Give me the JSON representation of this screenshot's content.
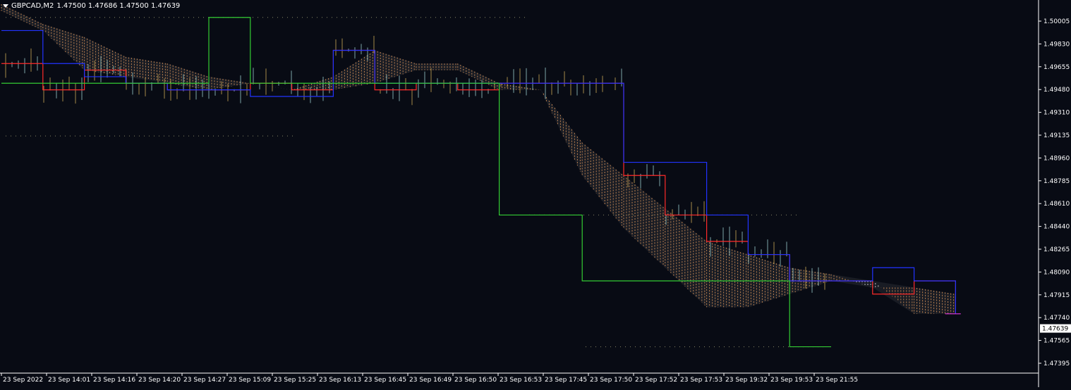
{
  "header": {
    "symbol": "GBPCAD,M2",
    "ohlc": "1.47500 1.47686 1.47500 1.47639"
  },
  "colors": {
    "background": "#080b14",
    "axis": "#ffffff",
    "tenkan": "#ff2a2a",
    "kijun": "#2233ff",
    "chikou": "#33cc33",
    "span_a": "#f4a460",
    "span_b": "#ffffff",
    "price_candles": "#99cccc",
    "close_line": "#cc33cc",
    "grid_dots": "#888866"
  },
  "chart_data": {
    "type": "line",
    "title": "GBPCAD,M2",
    "ylim": [
      1.473,
      1.501
    ],
    "y_ticks": [
      "1.50005",
      "1.49830",
      "1.49655",
      "1.49480",
      "1.49310",
      "1.49135",
      "1.48960",
      "1.48785",
      "1.48610",
      "1.48440",
      "1.48265",
      "1.48090",
      "1.47915",
      "1.47740",
      "1.47565",
      "1.47395"
    ],
    "x_ticks": [
      "23 Sep 2022",
      "23 Sep 14:01",
      "23 Sep 14:16",
      "23 Sep 14:20",
      "23 Sep 14:27",
      "23 Sep 15:09",
      "23 Sep 15:25",
      "23 Sep 16:13",
      "23 Sep 16:45",
      "23 Sep 16:49",
      "23 Sep 16:50",
      "23 Sep 16:53",
      "23 Sep 17:45",
      "23 Sep 17:50",
      "23 Sep 17:52",
      "23 Sep 17:53",
      "23 Sep 19:32",
      "23 Sep 19:53",
      "23 Sep 21:55"
    ],
    "current_price": "1.47639",
    "x": [
      0,
      4,
      8,
      12,
      16,
      20,
      24,
      28,
      32,
      36,
      40,
      44,
      48,
      52,
      56,
      60,
      64,
      68,
      72,
      76,
      80,
      84,
      88,
      92
    ],
    "series": [
      {
        "values": [
          1.4965,
          1.4945,
          1.496,
          1.495,
          1.4945,
          1.4945,
          1.495,
          1.4945,
          1.4975,
          1.4945,
          1.495,
          1.4945,
          1.495,
          1.495,
          1.495,
          1.488,
          1.485,
          1.483,
          1.482,
          1.48,
          1.48,
          1.479,
          1.48,
          1.4775
        ]
      },
      {
        "values": [
          1.499,
          1.4965,
          1.4955,
          1.495,
          1.4945,
          1.4945,
          1.494,
          1.494,
          1.4975,
          1.495,
          1.495,
          1.495,
          1.495,
          1.495,
          1.495,
          1.489,
          1.489,
          1.485,
          1.482,
          1.48,
          1.48,
          1.481,
          1.48,
          1.4775
        ]
      },
      {
        "values": [
          1.495,
          1.495,
          1.495,
          1.495,
          1.495,
          1.5,
          1.495,
          1.495,
          1.495,
          1.495,
          1.495,
          1.495,
          1.485,
          1.485,
          1.48,
          1.48,
          1.48,
          1.48,
          1.48,
          1.475,
          1.475,
          null,
          null,
          null
        ]
      },
      {
        "values": [
          1.501,
          1.4995,
          1.4985,
          1.497,
          1.4965,
          1.4955,
          1.495,
          1.4945,
          1.4955,
          1.4975,
          1.4965,
          1.4965,
          1.495,
          1.4945,
          1.4905,
          1.488,
          1.4855,
          1.483,
          1.482,
          1.481,
          1.4805,
          1.4795,
          1.4795,
          1.479
        ]
      },
      {
        "values": [
          1.5005,
          1.499,
          1.496,
          1.4955,
          1.495,
          1.4945,
          1.495,
          1.4945,
          1.4945,
          1.495,
          1.496,
          1.496,
          1.4945,
          1.4945,
          1.488,
          1.484,
          1.481,
          1.478,
          1.478,
          1.479,
          1.48,
          1.48,
          1.4775,
          1.4775
        ]
      }
    ]
  }
}
